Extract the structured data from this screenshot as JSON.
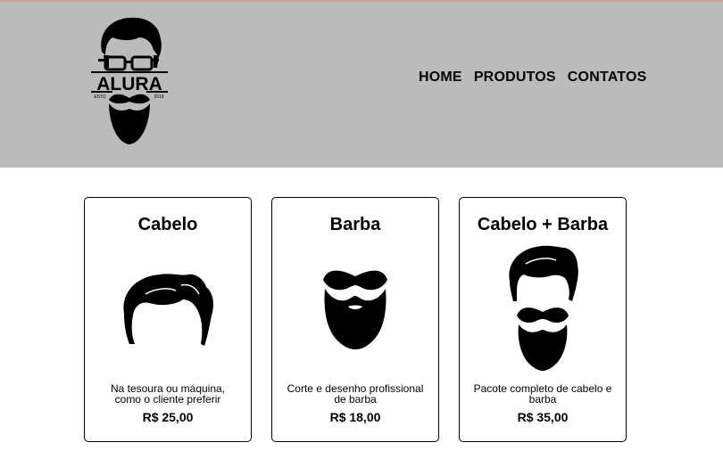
{
  "logo": {
    "brand": "ALURA",
    "est_left": "ESTD",
    "est_right": "2019"
  },
  "nav": {
    "items": [
      {
        "label": "HOME"
      },
      {
        "label": "PRODUTOS"
      },
      {
        "label": "CONTATOS"
      }
    ]
  },
  "products": [
    {
      "title": "Cabelo",
      "description": "Na tesoura ou máquina, como o cliente preferir",
      "price": "R$ 25,00",
      "icon": "hair-icon"
    },
    {
      "title": "Barba",
      "description": "Corte e desenho profissional de barba",
      "price": "R$ 18,00",
      "icon": "beard-icon"
    },
    {
      "title": "Cabelo + Barba",
      "description": "Pacote completo de cabelo e barba",
      "price": "R$ 35,00",
      "icon": "hair-and-beard-icon"
    }
  ]
}
